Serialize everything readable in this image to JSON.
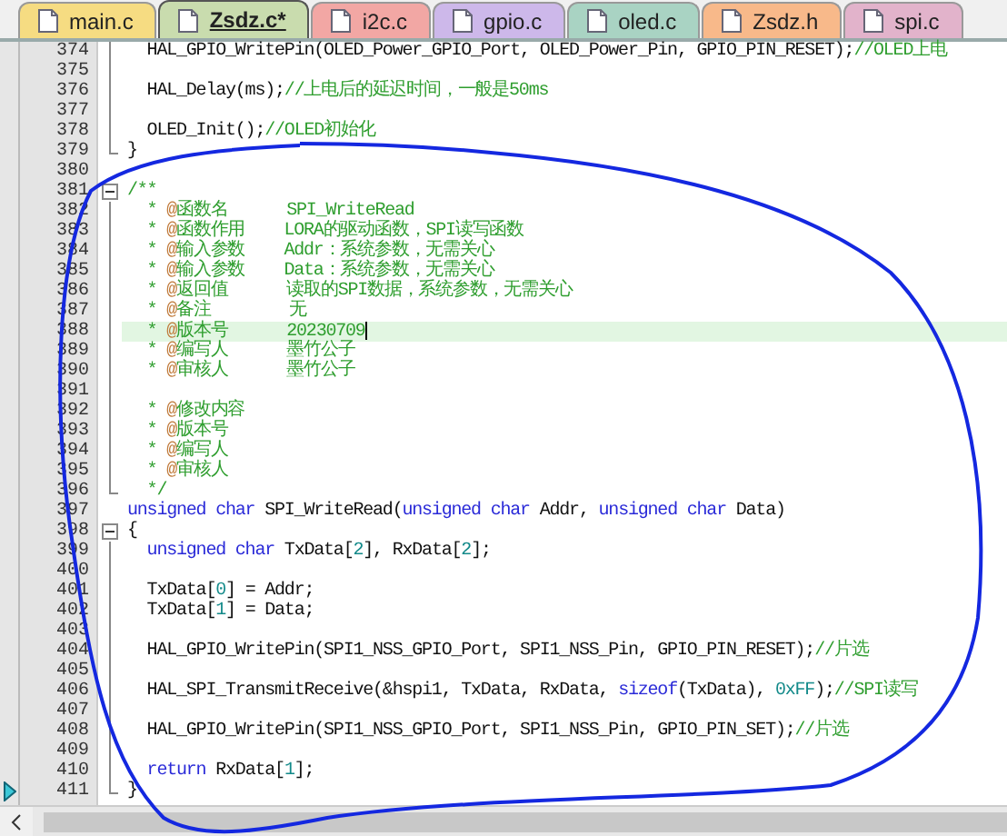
{
  "tabs": [
    {
      "label": "main.c",
      "selected": false,
      "color": "#f6dc82"
    },
    {
      "label": "Zsdz.c*",
      "selected": true,
      "color": "#c9dcae"
    },
    {
      "label": "i2c.c",
      "selected": false,
      "color": "#f2a7a4"
    },
    {
      "label": "gpio.c",
      "selected": false,
      "color": "#cdb8ea"
    },
    {
      "label": "oled.c",
      "selected": false,
      "color": "#a9d3c3"
    },
    {
      "label": "Zsdz.h",
      "selected": false,
      "color": "#f8b98a"
    },
    {
      "label": "spi.c",
      "selected": false,
      "color": "#e2b3cb"
    }
  ],
  "editor": {
    "lines": [
      {
        "number": "374",
        "tokens": [
          {
            "kind": "plain",
            "text": "  HAL_GPIO_WritePin(OLED_Power_GPIO_Port, OLED_Power_Pin, GPIO_PIN_RESET);"
          },
          {
            "kind": "comment",
            "text": "//OLED上电"
          }
        ]
      },
      {
        "number": "375"
      },
      {
        "number": "376",
        "tokens": [
          {
            "kind": "plain",
            "text": "  HAL_Delay(ms);"
          },
          {
            "kind": "comment",
            "text": "//上电后的延迟时间，一般是50ms"
          }
        ]
      },
      {
        "number": "377"
      },
      {
        "number": "378",
        "tokens": [
          {
            "kind": "plain",
            "text": "  OLED_Init();"
          },
          {
            "kind": "comment",
            "text": "//OLED初始化"
          }
        ]
      },
      {
        "number": "379",
        "fold_end": true,
        "tokens": [
          {
            "kind": "plain",
            "text": "}"
          }
        ]
      },
      {
        "number": "380"
      },
      {
        "number": "381",
        "expanded": true,
        "tokens": [
          {
            "kind": "comment",
            "text": "/**"
          }
        ]
      },
      {
        "number": "382",
        "tokens": [
          {
            "kind": "comment",
            "text": "  * "
          },
          {
            "kind": "tag",
            "text": "@"
          },
          {
            "kind": "comment",
            "text": "函数名      SPI_WriteRead"
          }
        ]
      },
      {
        "number": "383",
        "tokens": [
          {
            "kind": "comment",
            "text": "  * "
          },
          {
            "kind": "tag",
            "text": "@"
          },
          {
            "kind": "comment",
            "text": "函数作用    LORA的驱动函数，SPI读写函数"
          }
        ]
      },
      {
        "number": "384",
        "tokens": [
          {
            "kind": "comment",
            "text": "  * "
          },
          {
            "kind": "tag",
            "text": "@"
          },
          {
            "kind": "comment",
            "text": "输入参数    Addr：系统参数，无需关心"
          }
        ]
      },
      {
        "number": "385",
        "tokens": [
          {
            "kind": "comment",
            "text": "  * "
          },
          {
            "kind": "tag",
            "text": "@"
          },
          {
            "kind": "comment",
            "text": "输入参数    Data：系统参数，无需关心"
          }
        ]
      },
      {
        "number": "386",
        "tokens": [
          {
            "kind": "comment",
            "text": "  * "
          },
          {
            "kind": "tag",
            "text": "@"
          },
          {
            "kind": "comment",
            "text": "返回值      读取的SPI数据，系统参数，无需关心"
          }
        ]
      },
      {
        "number": "387",
        "tokens": [
          {
            "kind": "comment",
            "text": "  * "
          },
          {
            "kind": "tag",
            "text": "@"
          },
          {
            "kind": "comment",
            "text": "备注        无"
          }
        ]
      },
      {
        "number": "388",
        "highlighted": true,
        "tokens": [
          {
            "kind": "comment",
            "text": "  * "
          },
          {
            "kind": "tag",
            "text": "@"
          },
          {
            "kind": "comment",
            "text": "版本号      20230709"
          }
        ]
      },
      {
        "number": "389",
        "tokens": [
          {
            "kind": "comment",
            "text": "  * "
          },
          {
            "kind": "tag",
            "text": "@"
          },
          {
            "kind": "comment",
            "text": "编写人      墨竹公子"
          }
        ]
      },
      {
        "number": "390",
        "tokens": [
          {
            "kind": "comment",
            "text": "  * "
          },
          {
            "kind": "tag",
            "text": "@"
          },
          {
            "kind": "comment",
            "text": "审核人      墨竹公子"
          }
        ]
      },
      {
        "number": "391"
      },
      {
        "number": "392",
        "tokens": [
          {
            "kind": "comment",
            "text": "  * "
          },
          {
            "kind": "tag",
            "text": "@"
          },
          {
            "kind": "comment",
            "text": "修改内容"
          }
        ]
      },
      {
        "number": "393",
        "tokens": [
          {
            "kind": "comment",
            "text": "  * "
          },
          {
            "kind": "tag",
            "text": "@"
          },
          {
            "kind": "comment",
            "text": "版本号"
          }
        ]
      },
      {
        "number": "394",
        "tokens": [
          {
            "kind": "comment",
            "text": "  * "
          },
          {
            "kind": "tag",
            "text": "@"
          },
          {
            "kind": "comment",
            "text": "编写人"
          }
        ]
      },
      {
        "number": "395",
        "tokens": [
          {
            "kind": "comment",
            "text": "  * "
          },
          {
            "kind": "tag",
            "text": "@"
          },
          {
            "kind": "comment",
            "text": "审核人"
          }
        ]
      },
      {
        "number": "396",
        "fold_end": true,
        "tokens": [
          {
            "kind": "comment",
            "text": "  */"
          }
        ]
      },
      {
        "number": "397",
        "tokens": [
          {
            "kind": "keyword",
            "text": "unsigned char"
          },
          {
            "kind": "plain",
            "text": " SPI_WriteRead("
          },
          {
            "kind": "keyword",
            "text": "unsigned char"
          },
          {
            "kind": "plain",
            "text": " Addr, "
          },
          {
            "kind": "keyword",
            "text": "unsigned char"
          },
          {
            "kind": "plain",
            "text": " Data)"
          }
        ]
      },
      {
        "number": "398",
        "expanded": true,
        "tokens": [
          {
            "kind": "plain",
            "text": "{"
          }
        ]
      },
      {
        "number": "399",
        "tokens": [
          {
            "kind": "keyword",
            "text": "  unsigned char"
          },
          {
            "kind": "plain",
            "text": " TxData["
          },
          {
            "kind": "number",
            "text": "2"
          },
          {
            "kind": "plain",
            "text": "], RxData["
          },
          {
            "kind": "number",
            "text": "2"
          },
          {
            "kind": "plain",
            "text": "];"
          }
        ]
      },
      {
        "number": "400"
      },
      {
        "number": "401",
        "tokens": [
          {
            "kind": "plain",
            "text": "  TxData["
          },
          {
            "kind": "number",
            "text": "0"
          },
          {
            "kind": "plain",
            "text": "] = Addr;"
          }
        ]
      },
      {
        "number": "402",
        "tokens": [
          {
            "kind": "plain",
            "text": "  TxData["
          },
          {
            "kind": "number",
            "text": "1"
          },
          {
            "kind": "plain",
            "text": "] = Data;"
          }
        ]
      },
      {
        "number": "403"
      },
      {
        "number": "404",
        "tokens": [
          {
            "kind": "plain",
            "text": "  HAL_GPIO_WritePin(SPI1_NSS_GPIO_Port, SPI1_NSS_Pin, GPIO_PIN_RESET);"
          },
          {
            "kind": "comment",
            "text": "//片选"
          }
        ]
      },
      {
        "number": "405"
      },
      {
        "number": "406",
        "tokens": [
          {
            "kind": "plain",
            "text": "  HAL_SPI_TransmitReceive(&hspi1, TxData, RxData, "
          },
          {
            "kind": "keyword",
            "text": "sizeof"
          },
          {
            "kind": "plain",
            "text": "(TxData), "
          },
          {
            "kind": "number",
            "text": "0xFF"
          },
          {
            "kind": "plain",
            "text": ");"
          },
          {
            "kind": "comment",
            "text": "//SPI读写"
          }
        ]
      },
      {
        "number": "407"
      },
      {
        "number": "408",
        "tokens": [
          {
            "kind": "plain",
            "text": "  HAL_GPIO_WritePin(SPI1_NSS_GPIO_Port, SPI1_NSS_Pin, GPIO_PIN_SET);"
          },
          {
            "kind": "comment",
            "text": "//片选"
          }
        ]
      },
      {
        "number": "409"
      },
      {
        "number": "410",
        "tokens": [
          {
            "kind": "keyword",
            "text": "  return"
          },
          {
            "kind": "plain",
            "text": " RxData["
          },
          {
            "kind": "number",
            "text": "1"
          },
          {
            "kind": "plain",
            "text": "];"
          }
        ]
      },
      {
        "number": "411",
        "fold_end": true,
        "marker": true,
        "tokens": [
          {
            "kind": "plain",
            "text": "}"
          }
        ]
      }
    ]
  }
}
